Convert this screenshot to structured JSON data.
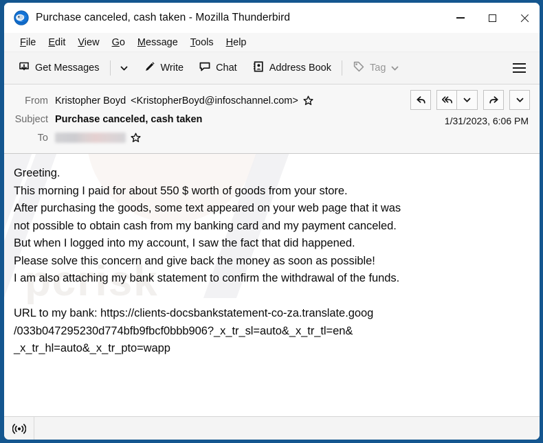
{
  "window": {
    "title": "Purchase canceled, cash taken - Mozilla Thunderbird",
    "app_icon": "thunderbird-logo-icon",
    "controls": {
      "minimize": "minimize-icon",
      "maximize": "maximize-icon",
      "close": "close-icon"
    }
  },
  "menubar": {
    "items": [
      {
        "label": "File",
        "accesskey": "F",
        "rest": "ile"
      },
      {
        "label": "Edit",
        "accesskey": "E",
        "rest": "dit"
      },
      {
        "label": "View",
        "accesskey": "V",
        "rest": "iew"
      },
      {
        "label": "Go",
        "accesskey": "G",
        "rest": "o"
      },
      {
        "label": "Message",
        "accesskey": "M",
        "rest": "essage"
      },
      {
        "label": "Tools",
        "accesskey": "T",
        "rest": "ools"
      },
      {
        "label": "Help",
        "accesskey": "H",
        "rest": "elp"
      }
    ]
  },
  "toolbar": {
    "get_messages_label": "Get Messages",
    "get_messages_icon": "get-messages-icon",
    "get_messages_dropdown_icon": "chevron-down-icon",
    "write_label": "Write",
    "write_icon": "pencil-icon",
    "chat_label": "Chat",
    "chat_icon": "chat-bubble-icon",
    "address_book_label": "Address Book",
    "address_book_icon": "address-book-icon",
    "tag_label": "Tag",
    "tag_icon": "tag-icon",
    "tag_dropdown_icon": "chevron-down-icon",
    "tag_disabled": true,
    "app_menu_icon": "hamburger-menu-icon"
  },
  "message_header": {
    "from_label": "From",
    "from_name": "Kristopher Boyd",
    "from_email": "<KristopherBoyd@infoschannel.com>",
    "subject_label": "Subject",
    "subject": "Purchase canceled, cash taken",
    "to_label": "To",
    "to_value_redacted": true,
    "date": "1/31/2023, 6:06 PM",
    "star_icon": "star-outline-icon",
    "actions": [
      {
        "name": "reply-button",
        "icon": "reply-arrow-icon"
      },
      {
        "name": "reply-all-button",
        "icon": "reply-all-arrow-icon"
      },
      {
        "name": "reply-dropdown-button",
        "icon": "chevron-down-icon"
      },
      {
        "name": "forward-button",
        "icon": "forward-arrow-icon"
      },
      {
        "name": "more-actions-dropdown-button",
        "icon": "chevron-down-icon"
      }
    ]
  },
  "message_body": {
    "lines": [
      "Greeting.",
      "This morning I paid for about 550 $ worth of goods from your store.",
      "After purchasing the goods, some text appeared on your web page that it was",
      "not possible to obtain cash from my banking card and my payment canceled.",
      "But when I logged into my account, I saw the fact that did happened.",
      "Please solve this concern and give back the money as soon as possible!",
      "I am also attaching my bank statement to confirm the withdrawal of the funds.",
      "",
      "URL to my bank: https://clients-docsbankstatement-co-za.translate.goog",
      "/033b047295230d774bfb9fbcf0bbb906?_x_tr_sl=auto&_x_tr_tl=en&",
      "_x_tr_hl=auto&_x_tr_pto=wapp"
    ]
  },
  "statusbar": {
    "icon": "broadcast-antenna-icon",
    "text": ""
  },
  "colors": {
    "window_border": "#14568f",
    "toolbar_bg": "#f4f4f4",
    "header_bg": "#f7f7f7",
    "body_bg": "#ffffff",
    "text": "#0a0a0a"
  }
}
